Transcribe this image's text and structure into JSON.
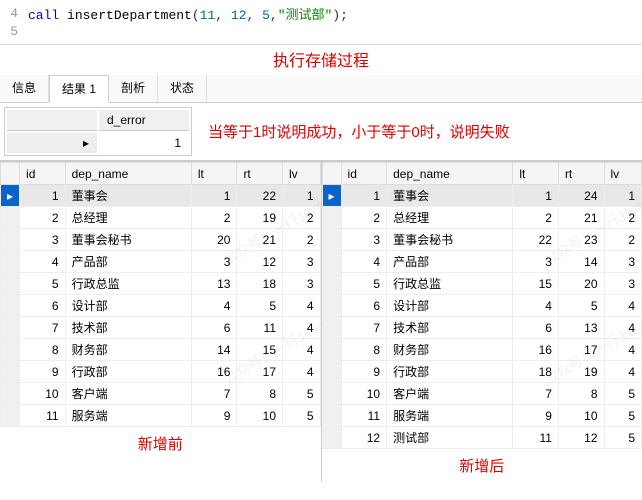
{
  "code": {
    "lines": [
      {
        "n": "4",
        "t": [
          {
            "c": "kw",
            "v": "call"
          },
          {
            "c": "punct",
            "v": " "
          },
          {
            "c": "fn",
            "v": "insertDepartment"
          },
          {
            "c": "punct",
            "v": "("
          },
          {
            "c": "num",
            "v": "11"
          },
          {
            "c": "punct",
            "v": ", "
          },
          {
            "c": "num",
            "v": "12"
          },
          {
            "c": "punct",
            "v": ", "
          },
          {
            "c": "num",
            "v": "5"
          },
          {
            "c": "punct",
            "v": ","
          },
          {
            "c": "str",
            "v": "\"测试部\""
          },
          {
            "c": "punct",
            "v": ");"
          }
        ]
      },
      {
        "n": "5",
        "t": []
      }
    ]
  },
  "annotations": {
    "top": "执行存储过程",
    "mid": "当等于1时说明成功，小于等于0时，说明失败",
    "left_caption": "新增前",
    "right_caption": "新增后"
  },
  "tabs": [
    "信息",
    "结果 1",
    "剖析",
    "状态"
  ],
  "active_tab_index": 1,
  "d_error": {
    "header": "d_error",
    "value": "1"
  },
  "grid_headers": [
    "id",
    "dep_name",
    "lt",
    "rt",
    "lv"
  ],
  "grid_left": [
    {
      "id": "1",
      "dep_name": "董事会",
      "lt": "1",
      "rt": "22",
      "lv": "1"
    },
    {
      "id": "2",
      "dep_name": "总经理",
      "lt": "2",
      "rt": "19",
      "lv": "2"
    },
    {
      "id": "3",
      "dep_name": "董事会秘书",
      "lt": "20",
      "rt": "21",
      "lv": "2"
    },
    {
      "id": "4",
      "dep_name": "产品部",
      "lt": "3",
      "rt": "12",
      "lv": "3"
    },
    {
      "id": "5",
      "dep_name": "行政总监",
      "lt": "13",
      "rt": "18",
      "lv": "3"
    },
    {
      "id": "6",
      "dep_name": "设计部",
      "lt": "4",
      "rt": "5",
      "lv": "4"
    },
    {
      "id": "7",
      "dep_name": "技术部",
      "lt": "6",
      "rt": "11",
      "lv": "4"
    },
    {
      "id": "8",
      "dep_name": "财务部",
      "lt": "14",
      "rt": "15",
      "lv": "4"
    },
    {
      "id": "9",
      "dep_name": "行政部",
      "lt": "16",
      "rt": "17",
      "lv": "4"
    },
    {
      "id": "10",
      "dep_name": "客户端",
      "lt": "7",
      "rt": "8",
      "lv": "5"
    },
    {
      "id": "11",
      "dep_name": "服务端",
      "lt": "9",
      "rt": "10",
      "lv": "5"
    }
  ],
  "grid_right": [
    {
      "id": "1",
      "dep_name": "董事会",
      "lt": "1",
      "rt": "24",
      "lv": "1"
    },
    {
      "id": "2",
      "dep_name": "总经理",
      "lt": "2",
      "rt": "21",
      "lv": "2"
    },
    {
      "id": "3",
      "dep_name": "董事会秘书",
      "lt": "22",
      "rt": "23",
      "lv": "2"
    },
    {
      "id": "4",
      "dep_name": "产品部",
      "lt": "3",
      "rt": "14",
      "lv": "3"
    },
    {
      "id": "5",
      "dep_name": "行政总监",
      "lt": "15",
      "rt": "20",
      "lv": "3"
    },
    {
      "id": "6",
      "dep_name": "设计部",
      "lt": "4",
      "rt": "5",
      "lv": "4"
    },
    {
      "id": "7",
      "dep_name": "技术部",
      "lt": "6",
      "rt": "13",
      "lv": "4"
    },
    {
      "id": "8",
      "dep_name": "财务部",
      "lt": "16",
      "rt": "17",
      "lv": "4"
    },
    {
      "id": "9",
      "dep_name": "行政部",
      "lt": "18",
      "rt": "19",
      "lv": "4"
    },
    {
      "id": "10",
      "dep_name": "客户端",
      "lt": "7",
      "rt": "8",
      "lv": "5"
    },
    {
      "id": "11",
      "dep_name": "服务端",
      "lt": "9",
      "rt": "10",
      "lv": "5"
    },
    {
      "id": "12",
      "dep_name": "测试部",
      "lt": "11",
      "rt": "12",
      "lv": "5"
    }
  ],
  "watermark": "公众号：一行Java"
}
